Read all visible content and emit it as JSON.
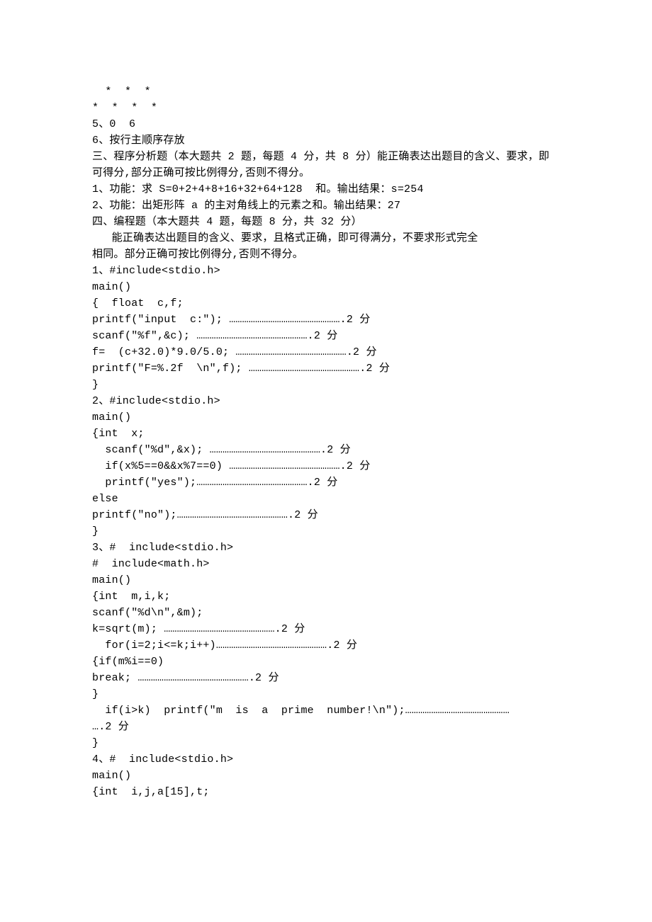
{
  "lines": [
    "  *  *  *",
    "*  *  *  *",
    "5、0  6",
    "6、按行主顺序存放",
    "三、程序分析题（本大题共 2 题，每题 4 分，共 8 分）能正确表达出题目的含义、要求，即",
    "可得分,部分正确可按比例得分,否则不得分。",
    "1、功能：求 S=0+2+4+8+16+32+64+128  和。输出结果：s=254",
    "2、功能：出矩形阵 a 的主对角线上的元素之和。输出结果：27",
    "四、编程题（本大题共 4 题，每题 8 分，共 32 分）",
    "   能正确表达出题目的含义、要求，且格式正确，即可得满分，不要求形式完全",
    "相同。部分正确可按比例得分,否则不得分。",
    "1、#include<stdio.h>",
    "main()",
    "{  float  c,f;",
    "printf(\"input  c:\"); …………………………………………….2 分",
    "scanf(\"%f\",&c); …………………………………………….2 分",
    "f=  (c+32.0)*9.0/5.0; …………………………………………….2 分",
    "printf(\"F=%.2f  \\n\",f); …………………………………………….2 分",
    "}",
    "2、#include<stdio.h>",
    "main()",
    "{int  x;",
    "  scanf(\"%d\",&x); …………………………………………….2 分",
    "  if(x%5==0&&x%7==0) …………………………………………….2 分",
    "  printf(\"yes\");…………………………………………….2 分",
    "else",
    "printf(\"no\");…………………………………………….2 分",
    "}",
    "3、#  include<stdio.h>",
    "#  include<math.h>",
    "main()",
    "{int  m,i,k;",
    "scanf(\"%d\\n\",&m);",
    "k=sqrt(m); …………………………………………….2 分",
    "  for(i=2;i<=k;i++)…………………………………………….2 分",
    "{if(m%i==0)",
    "break; …………………………………………….2 分",
    "}",
    "  if(i>k)  printf(\"m  is  a  prime  number!\\n\");…………………………………………",
    "….2 分",
    "}",
    "4、#  include<stdio.h>",
    "main()",
    "{int  i,j,a[15],t;"
  ]
}
